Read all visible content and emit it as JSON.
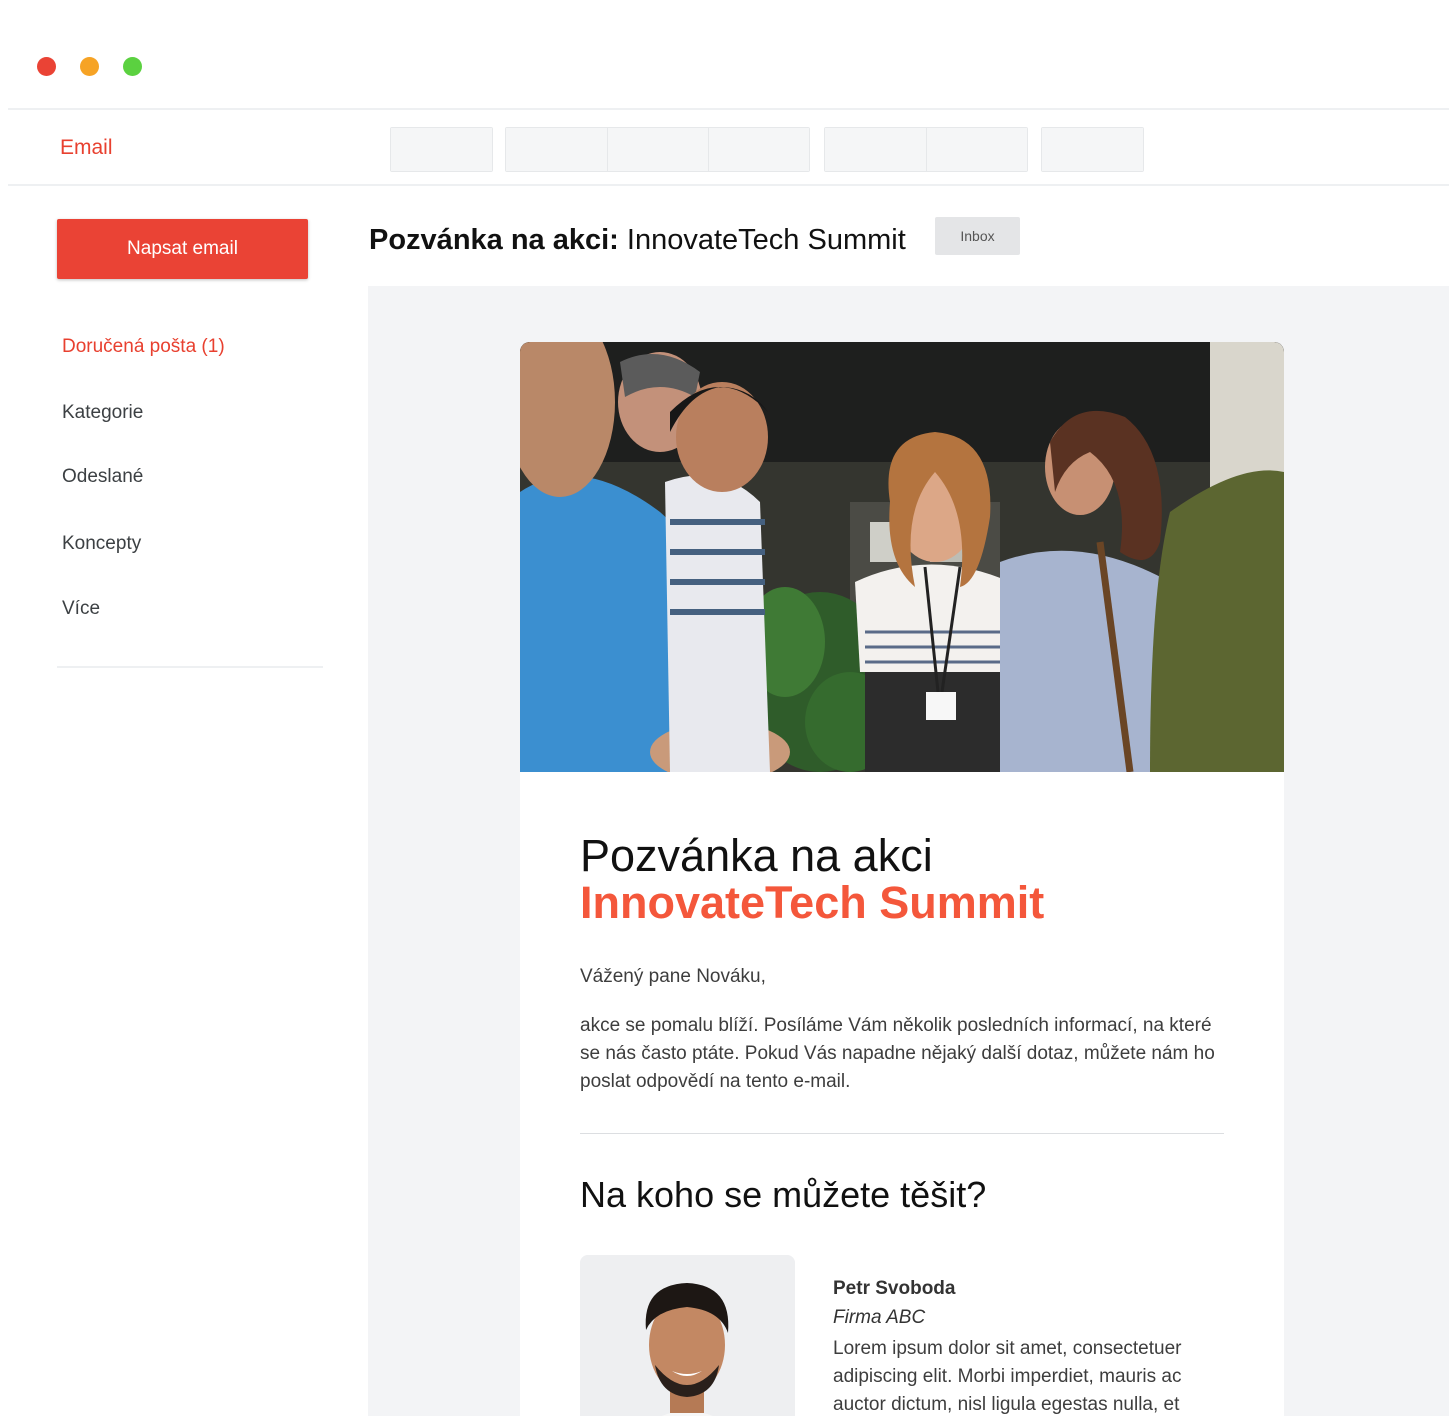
{
  "app": {
    "title": "Email"
  },
  "sidebar": {
    "compose_label": "Napsat email",
    "items": [
      {
        "label": "Doručená pošta (1)",
        "active": true
      },
      {
        "label": "Kategorie"
      },
      {
        "label": "Odeslané"
      },
      {
        "label": "Koncepty"
      },
      {
        "label": "Více"
      }
    ]
  },
  "message": {
    "subject_prefix": "Pozvánka na akci:",
    "subject_rest": " InnovateTech Summit",
    "folder_badge": "Inbox"
  },
  "email_body": {
    "title": "Pozvánka na akci",
    "title_accent": "InnovateTech Summit",
    "greeting": "Vážený pane Nováku,",
    "paragraph": "akce se pomalu blíží. Posíláme Vám několik posledních informací, na které se nás často ptáte. Pokud Vás napadne nějaký další dotaz, můžete nám ho poslat odpovědí na tento e-mail.",
    "section_title": "Na koho se můžete těšit?",
    "speaker": {
      "name": "Petr Svoboda",
      "company": "Firma ABC",
      "bio": "Lorem ipsum dolor sit amet, consectetuer adipiscing elit. Morbi imperdiet, mauris ac auctor dictum, nisl ligula egestas nulla, et"
    }
  },
  "colors": {
    "accent": "#ea4335",
    "accent_heading": "#f4573b",
    "viewport_bg": "#f3f4f6"
  }
}
